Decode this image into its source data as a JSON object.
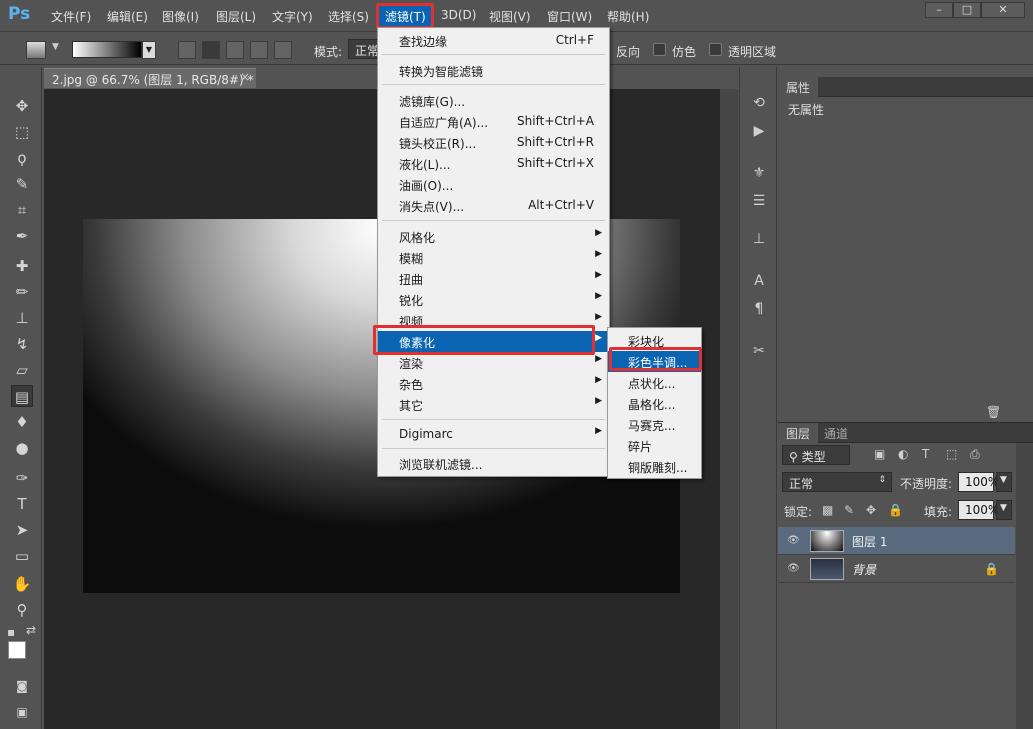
{
  "app": {
    "logo": "Ps"
  },
  "menubar": {
    "items": [
      "文件(F)",
      "编辑(E)",
      "图像(I)",
      "图层(L)",
      "文字(Y)",
      "选择(S)",
      "滤镜(T)",
      "3D(D)",
      "视图(V)",
      "窗口(W)",
      "帮助(H)"
    ],
    "active": "滤镜(T)",
    "window_buttons": {
      "minimize": "–",
      "restore": "□",
      "close": "✕"
    }
  },
  "options_bar": {
    "mode_label": "模式:",
    "mode_value": "正常",
    "checkboxes": [
      "反向",
      "仿色",
      "透明区域"
    ]
  },
  "document": {
    "tab_title": "2.jpg @ 66.7% (图层 1, RGB/8#) *",
    "tab_close": "×"
  },
  "filter_menu": {
    "items": [
      {
        "label": "查找边缘",
        "shortcut": "Ctrl+F"
      },
      {
        "label": "转换为智能滤镜"
      },
      {
        "label": "滤镜库(G)..."
      },
      {
        "label": "自适应广角(A)...",
        "shortcut": "Shift+Ctrl+A"
      },
      {
        "label": "镜头校正(R)...",
        "shortcut": "Shift+Ctrl+R"
      },
      {
        "label": "液化(L)...",
        "shortcut": "Shift+Ctrl+X"
      },
      {
        "label": "油画(O)..."
      },
      {
        "label": "消失点(V)...",
        "shortcut": "Alt+Ctrl+V"
      },
      {
        "label": "风格化",
        "submenu": true
      },
      {
        "label": "模糊",
        "submenu": true
      },
      {
        "label": "扭曲",
        "submenu": true
      },
      {
        "label": "锐化",
        "submenu": true
      },
      {
        "label": "视频",
        "submenu": true
      },
      {
        "label": "像素化",
        "submenu": true,
        "highlighted": true
      },
      {
        "label": "渲染",
        "submenu": true
      },
      {
        "label": "杂色",
        "submenu": true
      },
      {
        "label": "其它",
        "submenu": true
      },
      {
        "label": "Digimarc",
        "submenu": true
      },
      {
        "label": "浏览联机滤镜..."
      }
    ]
  },
  "pixelate_submenu": {
    "items": [
      "彩块化",
      "彩色半调...",
      "点状化...",
      "晶格化...",
      "马赛克...",
      "碎片",
      "铜版雕刻..."
    ],
    "highlighted": "彩色半调..."
  },
  "properties_panel": {
    "tab": "属性",
    "body": "无属性"
  },
  "layers_panel": {
    "tabs": [
      "图层",
      "通道"
    ],
    "filter_kind": "类型",
    "blend_mode": "正常",
    "opacity_label": "不透明度:",
    "opacity_value": "100%",
    "lock_label": "锁定:",
    "fill_label": "填充:",
    "fill_value": "100%",
    "layers": [
      {
        "name": "图层 1",
        "active": true
      },
      {
        "name": "背景",
        "locked": true
      }
    ]
  },
  "colors": {
    "accent_blue": "#0a64b2",
    "highlight_red": "#e03030",
    "ui_gray": "#535353"
  }
}
